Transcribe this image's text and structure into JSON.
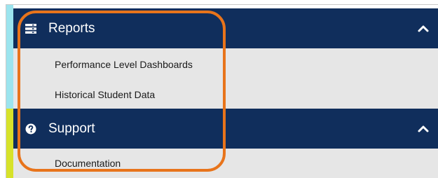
{
  "menu": {
    "reports": {
      "title": "Reports",
      "icon": "stacked-list-icon",
      "expanded": true,
      "items": [
        {
          "label": "Performance Level Dashboards"
        },
        {
          "label": "Historical Student Data"
        }
      ]
    },
    "support": {
      "title": "Support",
      "icon": "question-circle-icon",
      "expanded": true,
      "items": [
        {
          "label": "Documentation"
        }
      ]
    }
  },
  "colors": {
    "header_bg": "#102e5c",
    "item_bg": "#e6e6e6",
    "accent_cyan": "#9ce4ee",
    "accent_yellow": "#d7e22a",
    "highlight_orange": "#e8741b"
  }
}
